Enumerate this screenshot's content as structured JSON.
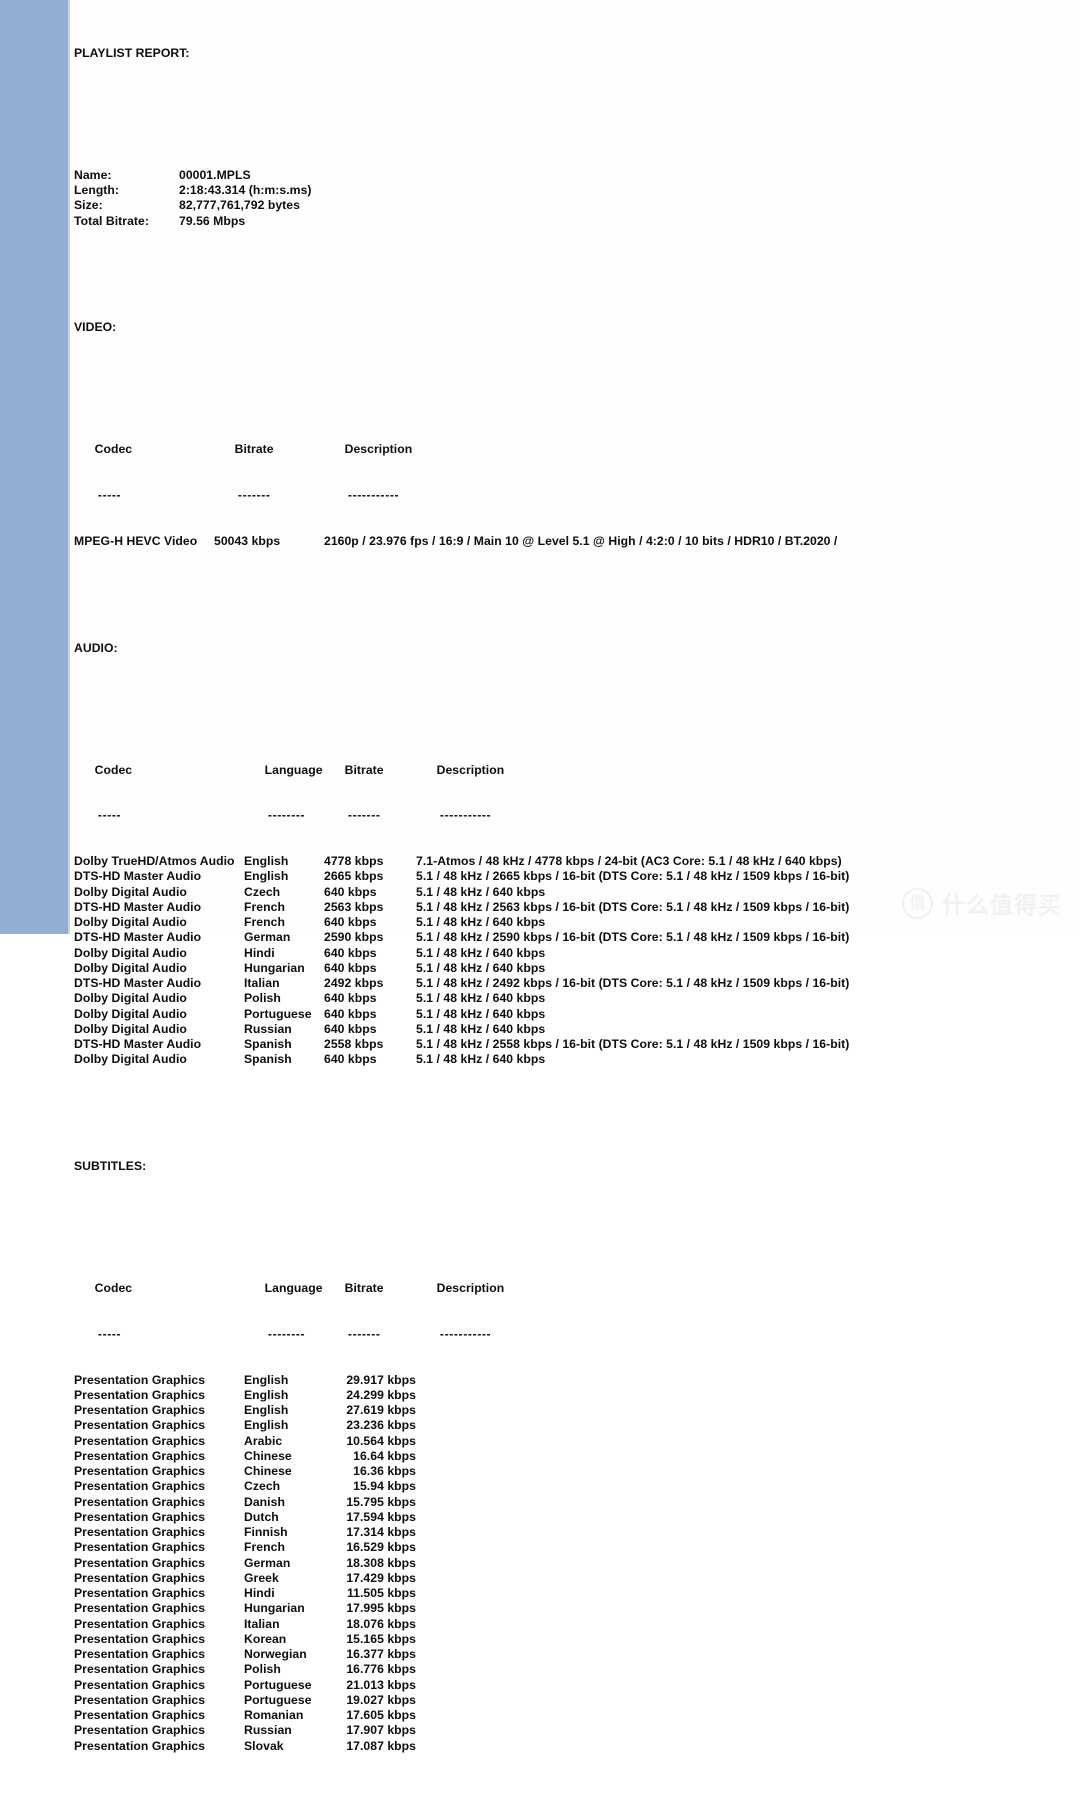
{
  "document": {
    "title": "PLAYLIST REPORT:",
    "summary": {
      "rows": [
        {
          "label": "Name:",
          "value": "00001.MPLS"
        },
        {
          "label": "Length:",
          "value": "2:18:43.314 (h:m:s.ms)"
        },
        {
          "label": "Size:",
          "value": "82,777,761,792 bytes"
        },
        {
          "label": "Total Bitrate:",
          "value": "79.56 Mbps"
        }
      ]
    },
    "video": {
      "heading": "VIDEO:",
      "columns": [
        "Codec",
        "Bitrate",
        "Description"
      ],
      "column_rules": [
        "-----",
        "-------",
        "-----------"
      ],
      "rows": [
        {
          "codec": "MPEG-H HEVC Video",
          "bitrate": "50043 kbps",
          "description": "2160p / 23.976 fps / 16:9 / Main 10 @ Level 5.1 @ High / 4:2:0 / 10 bits / HDR10 / BT.2020 /"
        }
      ]
    },
    "audio": {
      "heading": "AUDIO:",
      "columns": [
        "Codec",
        "Language",
        "Bitrate",
        "Description"
      ],
      "column_rules": [
        "-----",
        "--------",
        "-------",
        "-----------"
      ],
      "rows": [
        {
          "codec": "Dolby TrueHD/Atmos Audio",
          "language": "English",
          "bitrate": "4778 kbps",
          "description": "7.1-Atmos / 48 kHz / 4778 kbps / 24-bit (AC3 Core: 5.1 / 48 kHz / 640 kbps)"
        },
        {
          "codec": "DTS-HD Master Audio",
          "language": "English",
          "bitrate": "2665 kbps",
          "description": "5.1 / 48 kHz / 2665 kbps / 16-bit (DTS Core: 5.1 / 48 kHz / 1509 kbps / 16-bit)"
        },
        {
          "codec": "Dolby Digital Audio",
          "language": "Czech",
          "bitrate": "640 kbps",
          "description": "5.1 / 48 kHz / 640 kbps"
        },
        {
          "codec": "DTS-HD Master Audio",
          "language": "French",
          "bitrate": "2563 kbps",
          "description": "5.1 / 48 kHz / 2563 kbps / 16-bit (DTS Core: 5.1 / 48 kHz / 1509 kbps / 16-bit)"
        },
        {
          "codec": "Dolby Digital Audio",
          "language": "French",
          "bitrate": "640 kbps",
          "description": "5.1 / 48 kHz / 640 kbps"
        },
        {
          "codec": "DTS-HD Master Audio",
          "language": "German",
          "bitrate": "2590 kbps",
          "description": "5.1 / 48 kHz / 2590 kbps / 16-bit (DTS Core: 5.1 / 48 kHz / 1509 kbps / 16-bit)"
        },
        {
          "codec": "Dolby Digital Audio",
          "language": "Hindi",
          "bitrate": "640 kbps",
          "description": "5.1 / 48 kHz / 640 kbps"
        },
        {
          "codec": "Dolby Digital Audio",
          "language": "Hungarian",
          "bitrate": "640 kbps",
          "description": "5.1 / 48 kHz / 640 kbps"
        },
        {
          "codec": "DTS-HD Master Audio",
          "language": "Italian",
          "bitrate": "2492 kbps",
          "description": "5.1 / 48 kHz / 2492 kbps / 16-bit (DTS Core: 5.1 / 48 kHz / 1509 kbps / 16-bit)"
        },
        {
          "codec": "Dolby Digital Audio",
          "language": "Polish",
          "bitrate": "640 kbps",
          "description": "5.1 / 48 kHz / 640 kbps"
        },
        {
          "codec": "Dolby Digital Audio",
          "language": "Portuguese",
          "bitrate": "640 kbps",
          "description": "5.1 / 48 kHz / 640 kbps"
        },
        {
          "codec": "Dolby Digital Audio",
          "language": "Russian",
          "bitrate": "640 kbps",
          "description": "5.1 / 48 kHz / 640 kbps"
        },
        {
          "codec": "DTS-HD Master Audio",
          "language": "Spanish",
          "bitrate": "2558 kbps",
          "description": "5.1 / 48 kHz / 2558 kbps / 16-bit (DTS Core: 5.1 / 48 kHz / 1509 kbps / 16-bit)"
        },
        {
          "codec": "Dolby Digital Audio",
          "language": "Spanish",
          "bitrate": "640 kbps",
          "description": "5.1 / 48 kHz / 640 kbps"
        }
      ]
    },
    "subtitles": {
      "heading": "SUBTITLES:",
      "columns": [
        "Codec",
        "Language",
        "Bitrate",
        "Description"
      ],
      "column_rules": [
        "-----",
        "--------",
        "-------",
        "-----------"
      ],
      "rows": [
        {
          "codec": "Presentation Graphics",
          "language": "English",
          "bitrate": "29.917 kbps",
          "description": ""
        },
        {
          "codec": "Presentation Graphics",
          "language": "English",
          "bitrate": "24.299 kbps",
          "description": ""
        },
        {
          "codec": "Presentation Graphics",
          "language": "English",
          "bitrate": "27.619 kbps",
          "description": ""
        },
        {
          "codec": "Presentation Graphics",
          "language": "English",
          "bitrate": "23.236 kbps",
          "description": ""
        },
        {
          "codec": "Presentation Graphics",
          "language": "Arabic",
          "bitrate": "10.564 kbps",
          "description": ""
        },
        {
          "codec": "Presentation Graphics",
          "language": "Chinese",
          "bitrate": "16.64 kbps",
          "description": ""
        },
        {
          "codec": "Presentation Graphics",
          "language": "Chinese",
          "bitrate": "16.36 kbps",
          "description": ""
        },
        {
          "codec": "Presentation Graphics",
          "language": "Czech",
          "bitrate": "15.94 kbps",
          "description": ""
        },
        {
          "codec": "Presentation Graphics",
          "language": "Danish",
          "bitrate": "15.795 kbps",
          "description": ""
        },
        {
          "codec": "Presentation Graphics",
          "language": "Dutch",
          "bitrate": "17.594 kbps",
          "description": ""
        },
        {
          "codec": "Presentation Graphics",
          "language": "Finnish",
          "bitrate": "17.314 kbps",
          "description": ""
        },
        {
          "codec": "Presentation Graphics",
          "language": "French",
          "bitrate": "16.529 kbps",
          "description": ""
        },
        {
          "codec": "Presentation Graphics",
          "language": "German",
          "bitrate": "18.308 kbps",
          "description": ""
        },
        {
          "codec": "Presentation Graphics",
          "language": "Greek",
          "bitrate": "17.429 kbps",
          "description": ""
        },
        {
          "codec": "Presentation Graphics",
          "language": "Hindi",
          "bitrate": "11.505 kbps",
          "description": ""
        },
        {
          "codec": "Presentation Graphics",
          "language": "Hungarian",
          "bitrate": "17.995 kbps",
          "description": ""
        },
        {
          "codec": "Presentation Graphics",
          "language": "Italian",
          "bitrate": "18.076 kbps",
          "description": ""
        },
        {
          "codec": "Presentation Graphics",
          "language": "Korean",
          "bitrate": "15.165 kbps",
          "description": ""
        },
        {
          "codec": "Presentation Graphics",
          "language": "Norwegian",
          "bitrate": "16.377 kbps",
          "description": ""
        },
        {
          "codec": "Presentation Graphics",
          "language": "Polish",
          "bitrate": "16.776 kbps",
          "description": ""
        },
        {
          "codec": "Presentation Graphics",
          "language": "Portuguese",
          "bitrate": "21.013 kbps",
          "description": ""
        },
        {
          "codec": "Presentation Graphics",
          "language": "Portuguese",
          "bitrate": "19.027 kbps",
          "description": ""
        },
        {
          "codec": "Presentation Graphics",
          "language": "Romanian",
          "bitrate": "17.605 kbps",
          "description": ""
        },
        {
          "codec": "Presentation Graphics",
          "language": "Russian",
          "bitrate": "17.907 kbps",
          "description": ""
        },
        {
          "codec": "Presentation Graphics",
          "language": "Slovak",
          "bitrate": "17.087 kbps",
          "description": ""
        }
      ]
    }
  },
  "watermark": {
    "logo_glyph": "值",
    "text": "什么值得买"
  },
  "colors": {
    "left_band": "#92aed3",
    "band_edge": "#c8d4e6",
    "page_background": "#fefefe",
    "text": "#0d0d0d",
    "watermark": "#cfd4da"
  }
}
